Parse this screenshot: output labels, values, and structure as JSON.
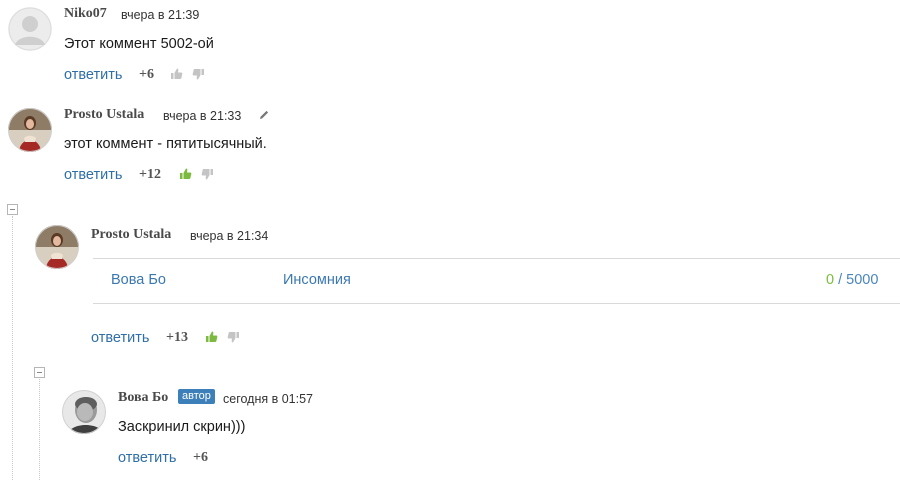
{
  "comments": [
    {
      "author": "Niko07",
      "time": "вчера в 21:39",
      "text": "Этот коммент 5002-ой",
      "reply_label": "ответить",
      "score": "+6"
    },
    {
      "author": "Prosto Ustala",
      "time": "вчера в 21:33",
      "text": "этот коммент - пятитысячный.",
      "reply_label": "ответить",
      "score": "+12"
    },
    {
      "author": "Prosto Ustala",
      "time": "вчера в 21:34",
      "attachment": {
        "item1": "Вова Бо",
        "item2": "Инсомния",
        "count": "0",
        "limit": "/ 5000"
      },
      "reply_label": "ответить",
      "score": "+13"
    },
    {
      "author": "Вова Бо",
      "badge": "автор",
      "time": "сегодня в 01:57",
      "text": "Заскринил скрин)))",
      "reply_label": "ответить",
      "score": "+6"
    }
  ],
  "colors": {
    "link": "#2f6fa8",
    "thumb_up_active": "#7cbb3f",
    "thumb_inactive": "#c4c4c4",
    "badge": "#3d7fb8"
  }
}
